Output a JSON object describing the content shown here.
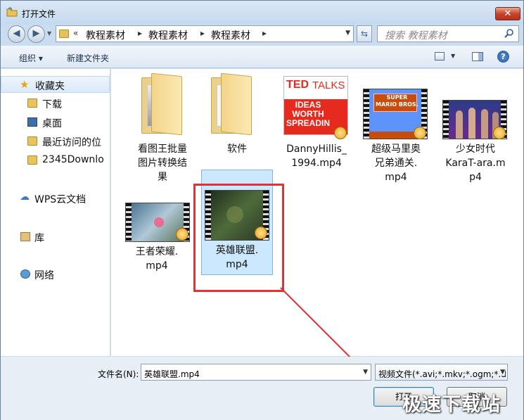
{
  "window": {
    "title": "打开文件"
  },
  "address": {
    "chevron": "«",
    "segments": [
      "教程素材",
      "教程素材",
      "教程素材"
    ]
  },
  "search": {
    "placeholder": "搜索 教程素材"
  },
  "toolbar": {
    "organize": "组织 ▾",
    "new_folder": "新建文件夹"
  },
  "nav": {
    "items": [
      {
        "label": "收藏夹",
        "icon": "star-icon"
      },
      {
        "label": "下载",
        "icon": "folder-icon"
      },
      {
        "label": "桌面",
        "icon": "desktop-icon"
      },
      {
        "label": "最近访问的位",
        "icon": "recent-icon"
      },
      {
        "label": "2345Downlo",
        "icon": "folder-icon"
      },
      {
        "label": "WPS云文档",
        "icon": "cloud-icon"
      },
      {
        "label": "库",
        "icon": "library-icon"
      },
      {
        "label": "网络",
        "icon": "network-icon"
      }
    ]
  },
  "files": [
    {
      "name": "看图王批量图片转换结果",
      "lines": [
        "看图王批量",
        "图片转换结",
        "果"
      ],
      "type": "folder"
    },
    {
      "name": "软件",
      "lines": [
        "软件"
      ],
      "type": "folder"
    },
    {
      "name": "DannyHillis_1994.mp4",
      "lines": [
        "DannyHillis_",
        "1994.mp4"
      ],
      "type": "video",
      "thumb_text": [
        "TED",
        "TALKS",
        "IDEAS",
        "WORTH",
        "SPREADIN"
      ]
    },
    {
      "name": "超级马里奥兄弟通关.mp4",
      "lines": [
        "超级马里奥",
        "兄弟通关.",
        "mp4"
      ],
      "type": "video",
      "thumb_text": [
        "SUPER",
        "MARIO BROS."
      ]
    },
    {
      "name": "少女时代KaraT-ara.mp4",
      "lines": [
        "少女时代",
        "KaraT-ara.m",
        "p4"
      ],
      "type": "video"
    },
    {
      "name": "王者荣耀.mp4",
      "lines": [
        "王者荣耀.",
        "mp4"
      ],
      "type": "video"
    },
    {
      "name": "英雄联盟.mp4",
      "lines": [
        "英雄联盟.",
        "mp4"
      ],
      "type": "video",
      "selected": true
    }
  ],
  "bottom": {
    "filename_label": "文件名(N):",
    "filename_value": "英雄联盟.mp4",
    "filetype_value": "视频文件(*.avi;*.mkv;*.ogm;*.d",
    "open_label": "打开",
    "cancel_label": "取消"
  },
  "watermark": "极速下载站",
  "colors": {
    "highlight": "#e03434",
    "selection": "#cce8ff"
  }
}
